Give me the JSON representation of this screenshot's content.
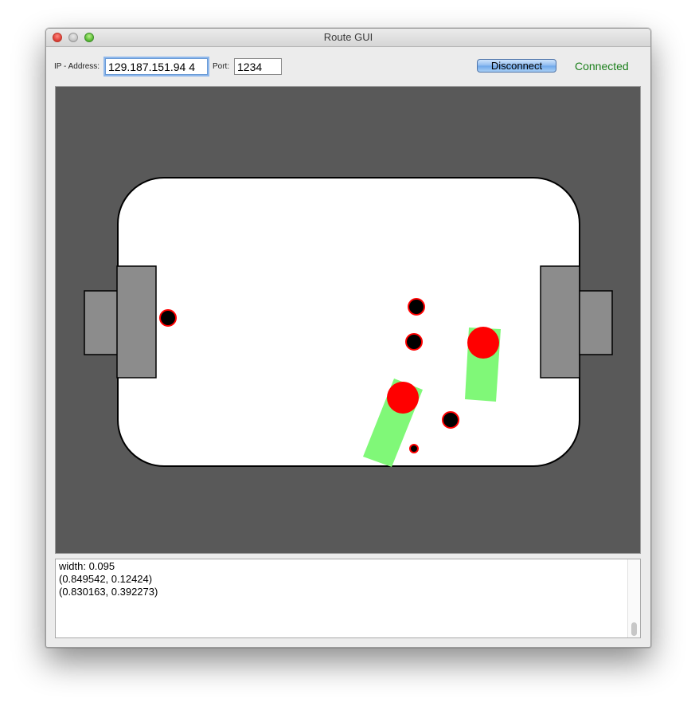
{
  "window": {
    "title": "Route GUI"
  },
  "toolbar": {
    "ip_label": "IP - Address:",
    "ip_value": "129.187.151.94 4",
    "port_label": "Port:",
    "port_value": "1234",
    "disconnect_label": "Disconnect",
    "status_text": "Connected",
    "status_color": "#1b7f1b"
  },
  "field": {
    "background": "#595959",
    "pitch_color": "#ffffff",
    "goal_color": "#8c8c8c",
    "robot_color": "#ff0000",
    "route_color": "#80f878",
    "obstacle_color": "#000000"
  },
  "console": {
    "lines": [
      "width: 0.095",
      "(0.849542, 0.12424)",
      "(0.830163, 0.392273)"
    ]
  }
}
